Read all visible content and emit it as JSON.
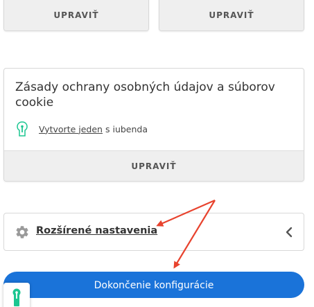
{
  "top_cards": {
    "left_button": "UPRAVIŤ",
    "right_button": "UPRAVIŤ"
  },
  "privacy_card": {
    "title": "Zásady ochrany osobných údajov a súborov cookie",
    "link_text": "Vytvorte jeden",
    "link_suffix": "s iubenda",
    "button": "UPRAVIŤ"
  },
  "advanced_settings": {
    "label": "Rozšírené nastavenia"
  },
  "finish_button": {
    "label": "Dokončenie konfigurácie"
  },
  "colors": {
    "primary": "#1a73d9",
    "annotation_arrow": "#e8432e",
    "iubenda_green": "#1cc691"
  },
  "icons": {
    "iubenda": "iubenda-keyhole-icon",
    "settings": "gear-icon",
    "collapse": "chevron-left-icon"
  }
}
